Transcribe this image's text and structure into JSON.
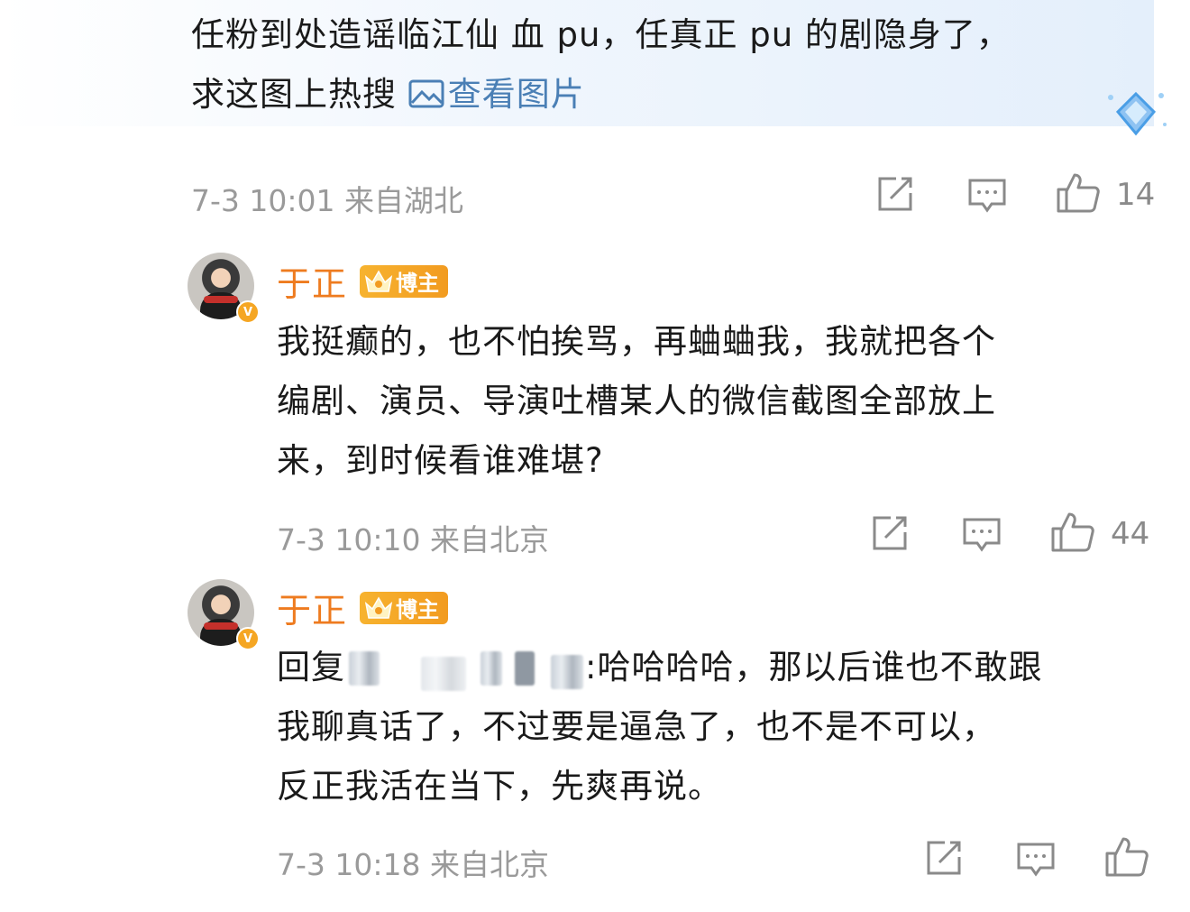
{
  "top_comment": {
    "line1": "任粉到处造谣临江仙 血 pu，任真正 pu 的剧隐身了，",
    "line2": "求这图上热搜 ",
    "view_image_link": "查看图片",
    "meta": "7-3 10:01 来自湖北",
    "like_count": "14"
  },
  "replies": [
    {
      "author": "于正",
      "badge": "博主",
      "lines": [
        "我挺癫的，也不怕挨骂，再蛐蛐我，我就把各个",
        "编剧、演员、导演吐槽某人的微信截图全部放上",
        "来，到时候看谁难堪?"
      ],
      "meta": "7-3 10:10 来自北京",
      "like_count": "44"
    },
    {
      "author": "于正",
      "badge": "博主",
      "reply_prefix": "回复",
      "reply_after_mention": ":哈哈哈哈，那以后谁也不敢跟",
      "lines": [
        "我聊真话了，不过要是逼急了，也不是不可以，",
        "反正我活在当下，先爽再说。"
      ],
      "meta": "7-3 10:18 来自北京",
      "like_count": ""
    }
  ],
  "colors": {
    "username": "#ee7b1f",
    "link": "#4a7fb5",
    "meta": "#9a9a9a",
    "badge": "#f29b20"
  },
  "icons": [
    "image-icon",
    "share-icon",
    "comment-icon",
    "like-icon",
    "verified-v-icon",
    "crown-icon",
    "sparkle-sticker-icon"
  ]
}
